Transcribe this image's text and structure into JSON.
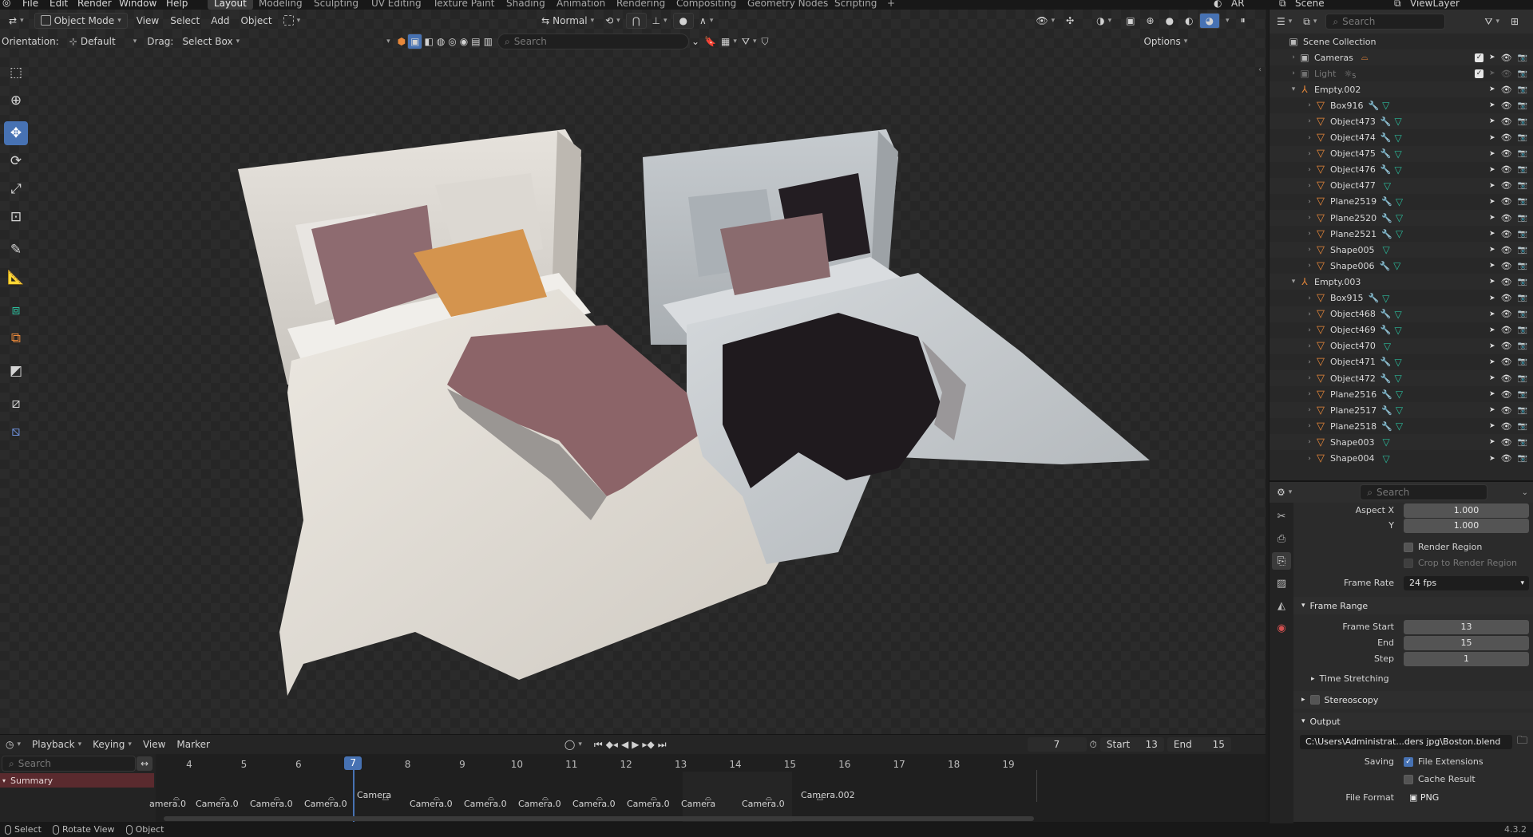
{
  "app": {
    "version": "4.3.2",
    "top_menu": [
      "File",
      "Edit",
      "Render",
      "Window",
      "Help"
    ],
    "workspaces": [
      "Layout",
      "Modeling",
      "Sculpting",
      "UV Editing",
      "Texture Paint",
      "Shading",
      "Animation",
      "Rendering",
      "Compositing",
      "Geometry Nodes",
      "Scripting"
    ],
    "active_workspace": "Layout",
    "add_workspace": "+",
    "scene_name": "Scene",
    "viewlayer_name": "ViewLayer",
    "ar_label": "AR"
  },
  "viewport": {
    "mode": "Object Mode",
    "menus": [
      "View",
      "Select",
      "Add",
      "Object"
    ],
    "transform_orientation": "Normal",
    "orientation_label": "Orientation:",
    "orientation_value": "Default",
    "drag_label": "Drag:",
    "drag_value": "Select Box",
    "search_placeholder": "Search",
    "options_label": "Options"
  },
  "toolbar": {
    "tools": [
      "select-box",
      "cursor",
      "move",
      "rotate",
      "scale",
      "transform",
      "annotate",
      "measure",
      "add-cube",
      "extrude",
      "bevel",
      "shear",
      "shrink"
    ],
    "active_tool": "move"
  },
  "timeline": {
    "menus": [
      "Playback",
      "Keying",
      "View",
      "Marker"
    ],
    "current_frame": "7",
    "start_label": "Start",
    "start_value": "13",
    "end_label": "End",
    "end_value": "15",
    "search_placeholder": "Search",
    "summary_label": "Summary",
    "frame_ticks": [
      "4",
      "5",
      "6",
      "7",
      "8",
      "9",
      "10",
      "11",
      "12",
      "13",
      "14",
      "15",
      "16",
      "17",
      "18",
      "19"
    ],
    "markers": [
      "amera.0",
      "Camera.0",
      "Camera.0",
      "Camera.0",
      "Camera",
      "Camera.0",
      "Camera.0",
      "Camera.0",
      "Camera.0",
      "Camera.0",
      "Camera",
      "Camera.0",
      "Camera.002"
    ]
  },
  "statusbar": {
    "items": [
      "Select",
      "Rotate View",
      "Object"
    ]
  },
  "outliner": {
    "search_placeholder": "Search",
    "root": "Scene Collection",
    "rows": [
      {
        "name": "Cameras",
        "kind": "collection",
        "indent": 1,
        "checked": true
      },
      {
        "name": "Light",
        "kind": "collection",
        "indent": 1,
        "checked": true,
        "dim": true,
        "badge": "5"
      },
      {
        "name": "Empty.002",
        "kind": "empty",
        "indent": 1,
        "expanded": true
      },
      {
        "name": "Box916",
        "kind": "mesh",
        "indent": 2,
        "modifier": true
      },
      {
        "name": "Object473",
        "kind": "mesh",
        "indent": 2,
        "modifier": true
      },
      {
        "name": "Object474",
        "kind": "mesh",
        "indent": 2,
        "modifier": true
      },
      {
        "name": "Object475",
        "kind": "mesh",
        "indent": 2,
        "modifier": true
      },
      {
        "name": "Object476",
        "kind": "mesh",
        "indent": 2,
        "modifier": true
      },
      {
        "name": "Object477",
        "kind": "mesh",
        "indent": 2,
        "modifier": false
      },
      {
        "name": "Plane2519",
        "kind": "mesh",
        "indent": 2,
        "modifier": true
      },
      {
        "name": "Plane2520",
        "kind": "mesh",
        "indent": 2,
        "modifier": true
      },
      {
        "name": "Plane2521",
        "kind": "mesh",
        "indent": 2,
        "modifier": true
      },
      {
        "name": "Shape005",
        "kind": "mesh",
        "indent": 2,
        "modifier": false
      },
      {
        "name": "Shape006",
        "kind": "mesh",
        "indent": 2,
        "modifier": true
      },
      {
        "name": "Empty.003",
        "kind": "empty",
        "indent": 1,
        "expanded": true
      },
      {
        "name": "Box915",
        "kind": "mesh",
        "indent": 2,
        "modifier": true
      },
      {
        "name": "Object468",
        "kind": "mesh",
        "indent": 2,
        "modifier": true
      },
      {
        "name": "Object469",
        "kind": "mesh",
        "indent": 2,
        "modifier": true
      },
      {
        "name": "Object470",
        "kind": "mesh",
        "indent": 2,
        "modifier": false
      },
      {
        "name": "Object471",
        "kind": "mesh",
        "indent": 2,
        "modifier": true
      },
      {
        "name": "Object472",
        "kind": "mesh",
        "indent": 2,
        "modifier": true
      },
      {
        "name": "Plane2516",
        "kind": "mesh",
        "indent": 2,
        "modifier": true
      },
      {
        "name": "Plane2517",
        "kind": "mesh",
        "indent": 2,
        "modifier": true
      },
      {
        "name": "Plane2518",
        "kind": "mesh",
        "indent": 2,
        "modifier": true
      },
      {
        "name": "Shape003",
        "kind": "mesh",
        "indent": 2,
        "modifier": false
      },
      {
        "name": "Shape004",
        "kind": "mesh",
        "indent": 2,
        "modifier": false
      }
    ]
  },
  "properties": {
    "search_placeholder": "Search",
    "aspect_x_label": "Aspect X",
    "aspect_x": "1.000",
    "aspect_y_label": "Y",
    "aspect_y": "1.000",
    "render_region": "Render Region",
    "crop_region": "Crop to Render Region",
    "frame_rate_label": "Frame Rate",
    "frame_rate": "24 fps",
    "frame_range_title": "Frame Range",
    "frame_start_label": "Frame Start",
    "frame_start": "13",
    "frame_end_label": "End",
    "frame_end": "15",
    "frame_step_label": "Step",
    "frame_step": "1",
    "time_stretching": "Time Stretching",
    "stereoscopy": "Stereoscopy",
    "output_title": "Output",
    "output_path": "C:\\Users\\Administrat...ders jpg\\Boston.blend",
    "saving_label": "Saving",
    "file_extensions": "File Extensions",
    "cache_result": "Cache Result",
    "file_format_label": "File Format",
    "file_format": "PNG"
  },
  "colors": {
    "accent": "#4772b3",
    "object_orange": "#e8883a",
    "mesh_green": "#2bbd9c",
    "modifier_blue": "#6d8fd8"
  }
}
